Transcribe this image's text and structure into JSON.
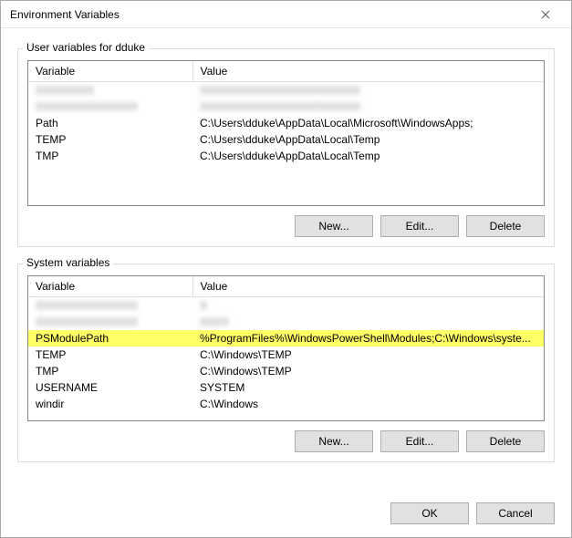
{
  "window": {
    "title": "Environment Variables"
  },
  "user_section": {
    "label": "User variables for dduke",
    "columns": {
      "variable": "Variable",
      "value": "Value"
    },
    "rows_blurred": [
      {
        "variable": "XXXXXXXX",
        "value": "XXXXXXXXXXXXXXXXXXXXXX"
      },
      {
        "variable": "XXXXXXXXXXXXXX",
        "value": "XXXXXXXXXXXXXXXXXXXXXX"
      }
    ],
    "rows": [
      {
        "variable": "Path",
        "value": "C:\\Users\\dduke\\AppData\\Local\\Microsoft\\WindowsApps;"
      },
      {
        "variable": "TEMP",
        "value": "C:\\Users\\dduke\\AppData\\Local\\Temp"
      },
      {
        "variable": "TMP",
        "value": "C:\\Users\\dduke\\AppData\\Local\\Temp"
      }
    ],
    "buttons": {
      "new": "New...",
      "edit": "Edit...",
      "delete": "Delete"
    }
  },
  "system_section": {
    "label": "System variables",
    "columns": {
      "variable": "Variable",
      "value": "Value"
    },
    "rows_blurred": [
      {
        "variable": "XXXXXXXXXXXXXX",
        "value": "X"
      },
      {
        "variable": "XXXXXXXXXXXXXX",
        "value": "XXXX"
      }
    ],
    "rows": [
      {
        "variable": "PSModulePath",
        "value": "%ProgramFiles%\\WindowsPowerShell\\Modules;C:\\Windows\\syste...",
        "highlight": true
      },
      {
        "variable": "TEMP",
        "value": "C:\\Windows\\TEMP"
      },
      {
        "variable": "TMP",
        "value": "C:\\Windows\\TEMP"
      },
      {
        "variable": "USERNAME",
        "value": "SYSTEM"
      },
      {
        "variable": "windir",
        "value": "C:\\Windows"
      }
    ],
    "buttons": {
      "new": "New...",
      "edit": "Edit...",
      "delete": "Delete"
    }
  },
  "footer": {
    "ok": "OK",
    "cancel": "Cancel"
  }
}
